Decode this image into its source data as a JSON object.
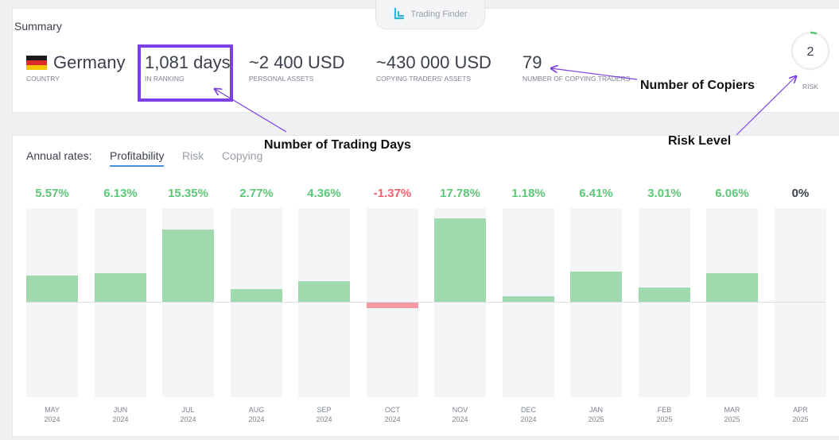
{
  "brand": {
    "name": "Trading Finder"
  },
  "summary": {
    "title": "Summary",
    "country": {
      "value": "Germany",
      "label": "COUNTRY"
    },
    "ranking": {
      "value": "1,081 days",
      "label": "IN RANKING"
    },
    "personal_assets": {
      "value": "~2 400 USD",
      "label": "PERSONAL ASSETS"
    },
    "copying_assets": {
      "value": "~430 000 USD",
      "label": "COPYING TRADERS' ASSETS"
    },
    "copiers": {
      "value": "79",
      "label": "NUMBER OF COPYING TRADERS"
    },
    "risk": {
      "value": "2",
      "label": "RISK"
    }
  },
  "annotations": {
    "copiers": "Number of Copiers",
    "trading_days": "Number of Trading Days",
    "risk_level": "Risk Level"
  },
  "rates": {
    "title": "Annual rates:",
    "tabs": [
      "Profitability",
      "Risk",
      "Copying"
    ],
    "active_tab": "Profitability"
  },
  "colors": {
    "positive": "#5cc777",
    "negative": "#f0616d",
    "positive_bar": "#9fd9ad",
    "negative_bar": "#f59aa4",
    "neutral": "#3a3f4b",
    "highlight": "#7b3fe4"
  },
  "chart_data": {
    "type": "bar",
    "categories": [
      "MAY 2024",
      "JUN 2024",
      "JUL 2024",
      "AUG 2024",
      "SEP 2024",
      "OCT 2024",
      "NOV 2024",
      "DEC 2024",
      "JAN 2025",
      "FEB 2025",
      "MAR 2025",
      "APR 2025"
    ],
    "values": [
      5.57,
      6.13,
      15.35,
      2.77,
      4.36,
      -1.37,
      17.78,
      1.18,
      6.41,
      3.01,
      6.06,
      0
    ],
    "labels": [
      "5.57%",
      "6.13%",
      "15.35%",
      "2.77%",
      "4.36%",
      "-1.37%",
      "17.78%",
      "1.18%",
      "6.41%",
      "3.01%",
      "6.06%",
      "0%"
    ],
    "months": [
      "MAY",
      "JUN",
      "JUL",
      "AUG",
      "SEP",
      "OCT",
      "NOV",
      "DEC",
      "JAN",
      "FEB",
      "MAR",
      "APR"
    ],
    "years": [
      "2024",
      "2024",
      "2024",
      "2024",
      "2024",
      "2024",
      "2024",
      "2024",
      "2025",
      "2025",
      "2025",
      "2025"
    ],
    "ylim": [
      -20,
      20
    ],
    "title": "",
    "xlabel": "",
    "ylabel": ""
  }
}
